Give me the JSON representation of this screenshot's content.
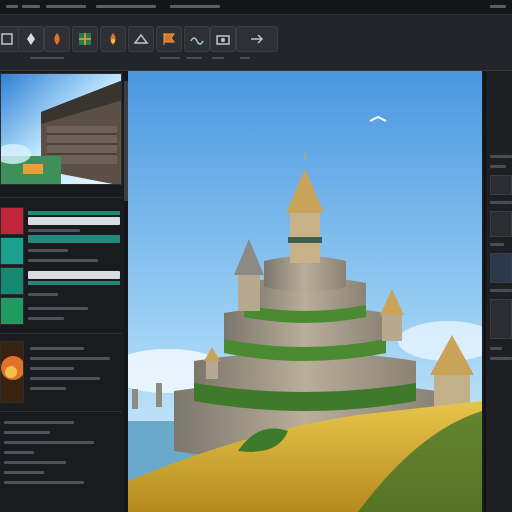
{
  "toolbar": {
    "buttons": [
      {
        "icon": "select-icon"
      },
      {
        "icon": "pin-icon"
      },
      {
        "icon": "flame-icon"
      },
      {
        "icon": "grid-icon"
      },
      {
        "icon": "flame-icon"
      },
      {
        "icon": "scale-icon"
      },
      {
        "icon": "orange-flag-icon"
      },
      {
        "icon": "wave-icon"
      },
      {
        "icon": "camera-icon"
      },
      {
        "icon": "arrow-icon"
      }
    ]
  },
  "colors": {
    "accent": "#e0722a",
    "teal": "#1f8a7c",
    "sky": "#5aa8e8",
    "grass": "#d8b83a"
  }
}
